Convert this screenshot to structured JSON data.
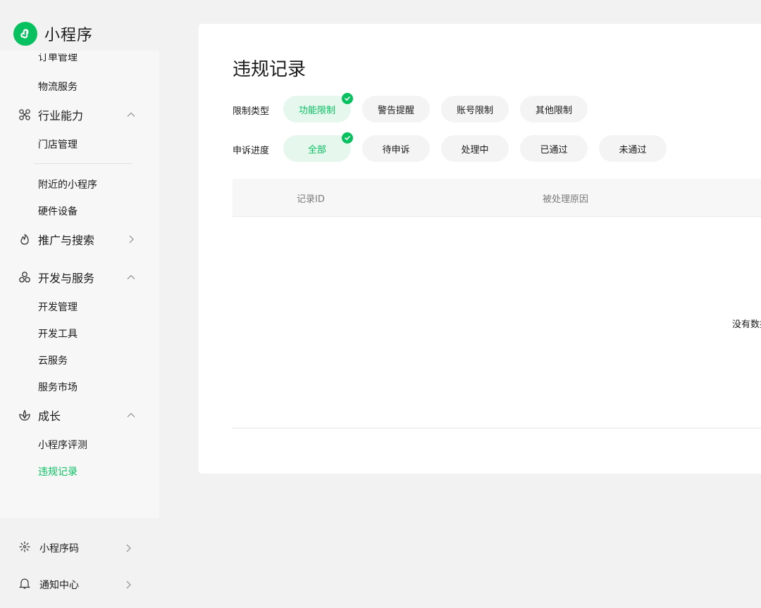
{
  "app": {
    "name": "小程序"
  },
  "sidebar": {
    "cut_item": "订单管理",
    "items_top": [
      "物流服务"
    ],
    "industry": {
      "label": "行业能力",
      "items": [
        "门店管理",
        "附近的小程序",
        "硬件设备"
      ]
    },
    "promotion": {
      "label": "推广与搜索"
    },
    "dev": {
      "label": "开发与服务",
      "items": [
        "开发管理",
        "开发工具",
        "云服务",
        "服务市场"
      ]
    },
    "growth": {
      "label": "成长",
      "items": [
        "小程序评测",
        "违规记录"
      ]
    },
    "bottom": [
      {
        "label": "小程序码",
        "icon": "sparkle-icon"
      },
      {
        "label": "通知中心",
        "icon": "bell-icon"
      }
    ]
  },
  "main": {
    "title": "违规记录",
    "filters": {
      "restriction": {
        "label": "限制类型",
        "options": [
          "功能限制",
          "警告提醒",
          "账号限制",
          "其他限制"
        ],
        "selected": "功能限制"
      },
      "appeal": {
        "label": "申诉进度",
        "options": [
          "全部",
          "待申诉",
          "处理中",
          "已通过",
          "未通过"
        ],
        "selected": "全部"
      }
    },
    "table": {
      "columns": [
        "记录ID",
        "被处理原因"
      ],
      "empty_text": "没有数据"
    }
  },
  "colors": {
    "accent": "#07c160",
    "accent_bg": "#e6f7ee",
    "chip_bg": "#f4f4f4"
  }
}
